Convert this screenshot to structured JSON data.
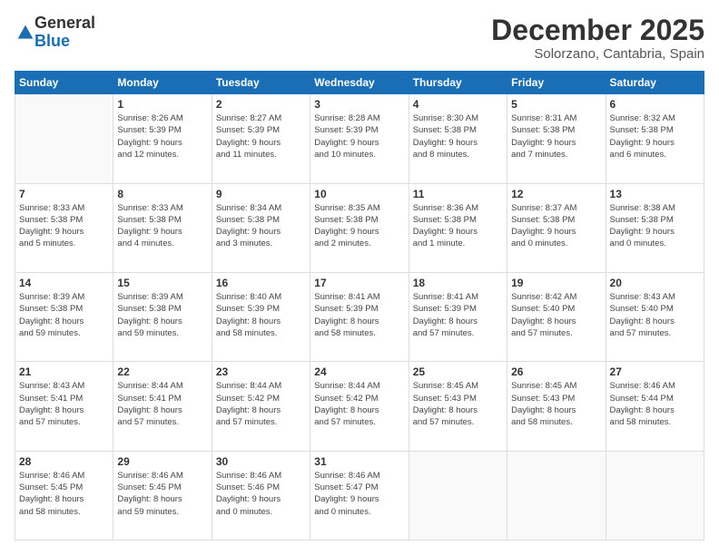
{
  "logo": {
    "general": "General",
    "blue": "Blue"
  },
  "title": "December 2025",
  "location": "Solorzano, Cantabria, Spain",
  "weekdays": [
    "Sunday",
    "Monday",
    "Tuesday",
    "Wednesday",
    "Thursday",
    "Friday",
    "Saturday"
  ],
  "days": [
    {
      "num": "",
      "info": ""
    },
    {
      "num": "1",
      "info": "Sunrise: 8:26 AM\nSunset: 5:39 PM\nDaylight: 9 hours\nand 12 minutes."
    },
    {
      "num": "2",
      "info": "Sunrise: 8:27 AM\nSunset: 5:39 PM\nDaylight: 9 hours\nand 11 minutes."
    },
    {
      "num": "3",
      "info": "Sunrise: 8:28 AM\nSunset: 5:39 PM\nDaylight: 9 hours\nand 10 minutes."
    },
    {
      "num": "4",
      "info": "Sunrise: 8:30 AM\nSunset: 5:38 PM\nDaylight: 9 hours\nand 8 minutes."
    },
    {
      "num": "5",
      "info": "Sunrise: 8:31 AM\nSunset: 5:38 PM\nDaylight: 9 hours\nand 7 minutes."
    },
    {
      "num": "6",
      "info": "Sunrise: 8:32 AM\nSunset: 5:38 PM\nDaylight: 9 hours\nand 6 minutes."
    },
    {
      "num": "7",
      "info": "Sunrise: 8:33 AM\nSunset: 5:38 PM\nDaylight: 9 hours\nand 5 minutes."
    },
    {
      "num": "8",
      "info": "Sunrise: 8:33 AM\nSunset: 5:38 PM\nDaylight: 9 hours\nand 4 minutes."
    },
    {
      "num": "9",
      "info": "Sunrise: 8:34 AM\nSunset: 5:38 PM\nDaylight: 9 hours\nand 3 minutes."
    },
    {
      "num": "10",
      "info": "Sunrise: 8:35 AM\nSunset: 5:38 PM\nDaylight: 9 hours\nand 2 minutes."
    },
    {
      "num": "11",
      "info": "Sunrise: 8:36 AM\nSunset: 5:38 PM\nDaylight: 9 hours\nand 1 minute."
    },
    {
      "num": "12",
      "info": "Sunrise: 8:37 AM\nSunset: 5:38 PM\nDaylight: 9 hours\nand 0 minutes."
    },
    {
      "num": "13",
      "info": "Sunrise: 8:38 AM\nSunset: 5:38 PM\nDaylight: 9 hours\nand 0 minutes."
    },
    {
      "num": "14",
      "info": "Sunrise: 8:39 AM\nSunset: 5:38 PM\nDaylight: 8 hours\nand 59 minutes."
    },
    {
      "num": "15",
      "info": "Sunrise: 8:39 AM\nSunset: 5:38 PM\nDaylight: 8 hours\nand 59 minutes."
    },
    {
      "num": "16",
      "info": "Sunrise: 8:40 AM\nSunset: 5:39 PM\nDaylight: 8 hours\nand 58 minutes."
    },
    {
      "num": "17",
      "info": "Sunrise: 8:41 AM\nSunset: 5:39 PM\nDaylight: 8 hours\nand 58 minutes."
    },
    {
      "num": "18",
      "info": "Sunrise: 8:41 AM\nSunset: 5:39 PM\nDaylight: 8 hours\nand 57 minutes."
    },
    {
      "num": "19",
      "info": "Sunrise: 8:42 AM\nSunset: 5:40 PM\nDaylight: 8 hours\nand 57 minutes."
    },
    {
      "num": "20",
      "info": "Sunrise: 8:43 AM\nSunset: 5:40 PM\nDaylight: 8 hours\nand 57 minutes."
    },
    {
      "num": "21",
      "info": "Sunrise: 8:43 AM\nSunset: 5:41 PM\nDaylight: 8 hours\nand 57 minutes."
    },
    {
      "num": "22",
      "info": "Sunrise: 8:44 AM\nSunset: 5:41 PM\nDaylight: 8 hours\nand 57 minutes."
    },
    {
      "num": "23",
      "info": "Sunrise: 8:44 AM\nSunset: 5:42 PM\nDaylight: 8 hours\nand 57 minutes."
    },
    {
      "num": "24",
      "info": "Sunrise: 8:44 AM\nSunset: 5:42 PM\nDaylight: 8 hours\nand 57 minutes."
    },
    {
      "num": "25",
      "info": "Sunrise: 8:45 AM\nSunset: 5:43 PM\nDaylight: 8 hours\nand 57 minutes."
    },
    {
      "num": "26",
      "info": "Sunrise: 8:45 AM\nSunset: 5:43 PM\nDaylight: 8 hours\nand 58 minutes."
    },
    {
      "num": "27",
      "info": "Sunrise: 8:46 AM\nSunset: 5:44 PM\nDaylight: 8 hours\nand 58 minutes."
    },
    {
      "num": "28",
      "info": "Sunrise: 8:46 AM\nSunset: 5:45 PM\nDaylight: 8 hours\nand 58 minutes."
    },
    {
      "num": "29",
      "info": "Sunrise: 8:46 AM\nSunset: 5:45 PM\nDaylight: 8 hours\nand 59 minutes."
    },
    {
      "num": "30",
      "info": "Sunrise: 8:46 AM\nSunset: 5:46 PM\nDaylight: 9 hours\nand 0 minutes."
    },
    {
      "num": "31",
      "info": "Sunrise: 8:46 AM\nSunset: 5:47 PM\nDaylight: 9 hours\nand 0 minutes."
    },
    {
      "num": "",
      "info": ""
    },
    {
      "num": "",
      "info": ""
    },
    {
      "num": "",
      "info": ""
    },
    {
      "num": "",
      "info": ""
    }
  ]
}
